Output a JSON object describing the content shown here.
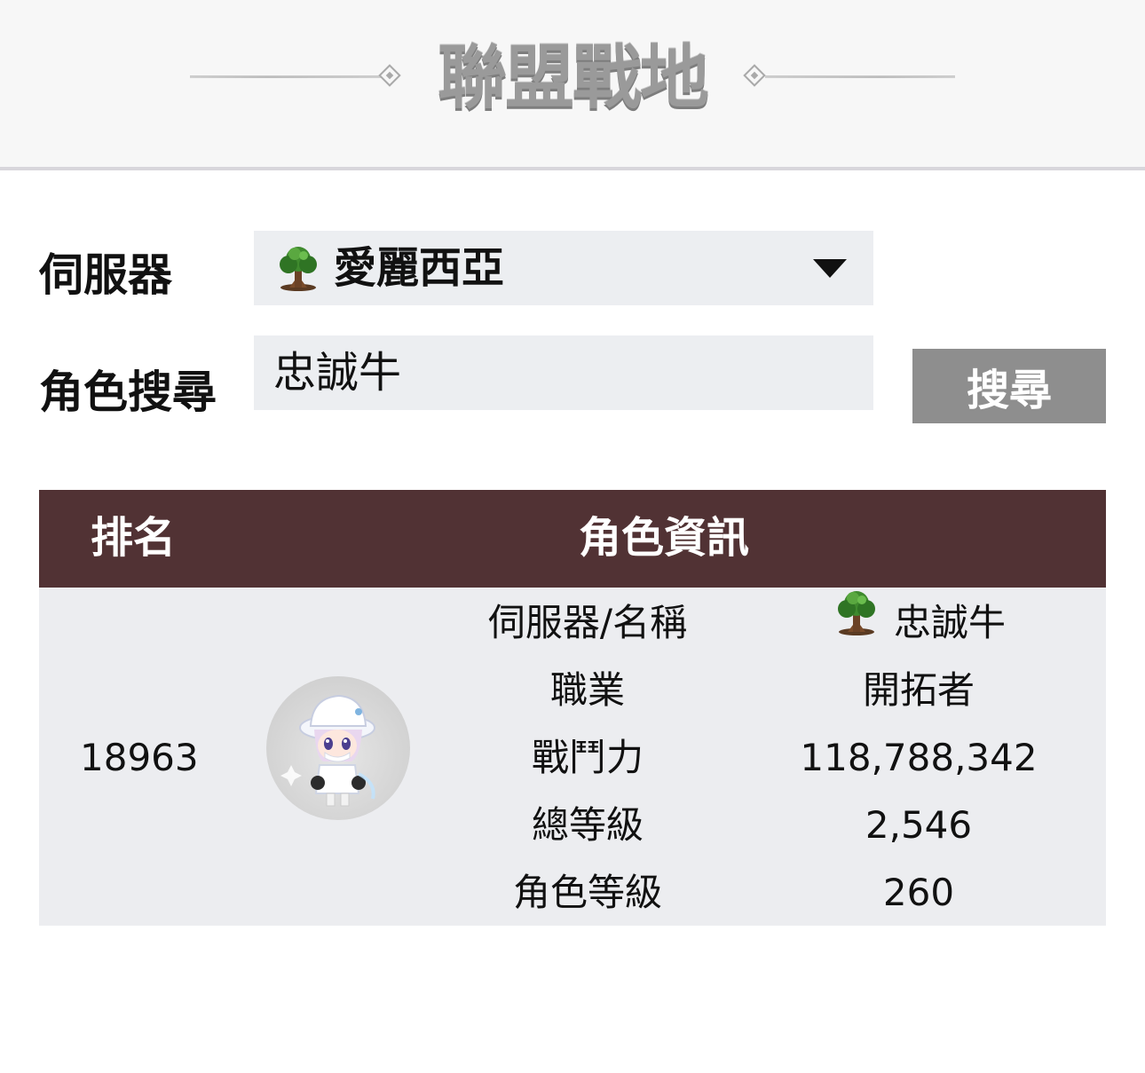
{
  "header": {
    "title": "聯盟戰地"
  },
  "form": {
    "server_label": "伺服器",
    "server_value": "愛麗西亞",
    "server_icon": "tree-icon",
    "character_label": "角色搜尋",
    "character_value": "忠誠牛",
    "search_button": "搜尋"
  },
  "table": {
    "headers": {
      "rank": "排名",
      "info": "角色資訊"
    },
    "row": {
      "rank": "18963",
      "avatar": "character-avatar",
      "fields": [
        {
          "key": "伺服器/名稱",
          "value": "忠誠牛",
          "icon": "tree-icon"
        },
        {
          "key": "職業",
          "value": "開拓者"
        },
        {
          "key": "戰鬥力",
          "value": "118,788,342"
        },
        {
          "key": "總等級",
          "value": "2,546"
        },
        {
          "key": "角色等級",
          "value": "260"
        }
      ]
    }
  },
  "colors": {
    "header_bg": "#f7f7f7",
    "table_header_bg": "#513234",
    "table_body_bg": "#ecedf0",
    "input_bg": "#eceef1",
    "button_bg": "#8e8e8e"
  }
}
